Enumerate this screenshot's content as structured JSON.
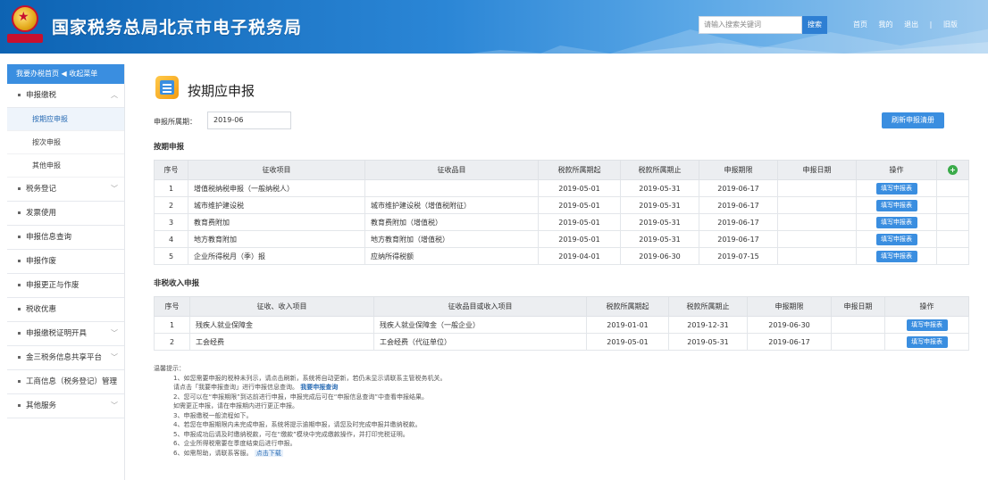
{
  "header": {
    "title": "国家税务总局北京市电子税务局",
    "search_placeholder": "请输入搜索关键词",
    "search_button": "搜索",
    "links": [
      "首页",
      "我的",
      "退出",
      "|",
      "旧版"
    ]
  },
  "colors": {
    "brand": "#0d63b3",
    "accent": "#3a8ee0",
    "add": "#3aab4a"
  },
  "sidebar": {
    "head": "我要办税首页   ◀ 收起菜单",
    "items": [
      {
        "label": "申报缴税",
        "expanded": true,
        "children": [
          "按期应申报",
          "按次申报",
          "其他申报"
        ]
      },
      {
        "label": "税务登记",
        "expanded": false,
        "children": []
      },
      {
        "label": "发票使用",
        "expanded": false,
        "children": []
      },
      {
        "label": "申报信息查询",
        "expanded": false,
        "children": []
      },
      {
        "label": "申报作废",
        "expanded": false,
        "children": []
      },
      {
        "label": "申报更正与作废",
        "expanded": false,
        "children": []
      },
      {
        "label": "税收优惠",
        "expanded": false,
        "children": []
      },
      {
        "label": "申报缴税证明开具",
        "expanded": false,
        "children": []
      },
      {
        "label": "金三税务信息共享平台",
        "expanded": false,
        "children": []
      },
      {
        "label": "工商信息（税务登记）管理",
        "expanded": false,
        "children": []
      },
      {
        "label": "其他服务",
        "expanded": false,
        "children": []
      }
    ]
  },
  "main": {
    "page_title": "按期应申报",
    "period_label": "申报所属期：",
    "period_value": "2019-06",
    "top_button": "刷新申报清册",
    "section1": {
      "title": "按期申报",
      "headers": [
        "序号",
        "征收项目",
        "征收品目",
        "税款所属期起",
        "税款所属期止",
        "申报期限",
        "申报日期",
        "操作"
      ],
      "rows": [
        [
          "1",
          "增值税纳税申报（一般纳税人）",
          "",
          "2019-05-01",
          "2019-05-31",
          "2019-06-17",
          "",
          "填写申报表"
        ],
        [
          "2",
          "城市维护建设税",
          "城市维护建设税（增值税附征）",
          "2019-05-01",
          "2019-05-31",
          "2019-06-17",
          "",
          "填写申报表"
        ],
        [
          "3",
          "教育费附加",
          "教育费附加（增值税）",
          "2019-05-01",
          "2019-05-31",
          "2019-06-17",
          "",
          "填写申报表"
        ],
        [
          "4",
          "地方教育附加",
          "地方教育附加（增值税）",
          "2019-05-01",
          "2019-05-31",
          "2019-06-17",
          "",
          "填写申报表"
        ],
        [
          "5",
          "企业所得税月（季）报",
          "应纳所得税额",
          "2019-04-01",
          "2019-06-30",
          "2019-07-15",
          "",
          "填写申报表"
        ]
      ]
    },
    "section2": {
      "title": "非税收入申报",
      "headers": [
        "序号",
        "征收、收入项目",
        "征收品目或收入项目",
        "税款所属期起",
        "税款所属期止",
        "申报期限",
        "申报日期",
        "操作"
      ],
      "rows": [
        [
          "1",
          "残疾人就业保障金",
          "残疾人就业保障金（一般企业）",
          "2019-01-01",
          "2019-12-31",
          "2019-06-30",
          "",
          "填写申报表"
        ],
        [
          "2",
          "工会经费",
          "工会经费（代征单位）",
          "2019-05-01",
          "2019-05-31",
          "2019-06-17",
          "",
          "填写申报表"
        ]
      ]
    },
    "notes": {
      "title": "温馨提示：",
      "lines": [
        "1、如您需要申报的税种未列示，请点击刷新，系统将自动更新，若仍未显示请联系主管税务机关。",
        "请点击「我要申报查询」进行申报信息查询。",
        "2、您可以在“申报期限”到达前进行申报，申报完成后可在“申报信息查询”中查看申报结果。",
        "如需更正申报，请在申报期内进行更正申报。",
        "3、申报缴税一般流程如下。",
        "4、若您在申报期限内未完成申报，系统将提示逾期申报，请您及时完成申报并缴纳税款。",
        "5、申报成功后请及时缴纳税款，可在“缴款”模块中完成缴款操作，并打印完税证明。",
        "6、企业所得税需要在季度结束后进行申报。",
        "6、如需帮助，请联系客服。"
      ],
      "link1": "我要申报查询",
      "link2": "点击下载"
    }
  }
}
